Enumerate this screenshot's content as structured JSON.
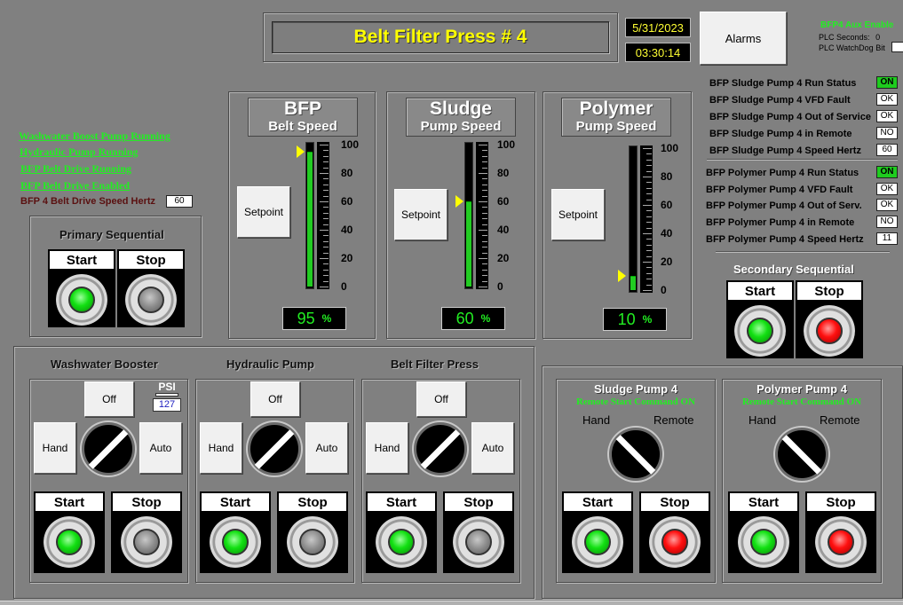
{
  "header": {
    "title": "Belt Filter Press # 4",
    "date": "5/31/2023",
    "time": "03:30:14",
    "alarms_label": "Alarms"
  },
  "aux": {
    "title": "BFP4 Aux Enable",
    "plc_seconds_label": "PLC Seconds:",
    "plc_seconds_value": "0",
    "plc_watchdog_label": "PLC WatchDog Bit"
  },
  "left_status": {
    "items": [
      "Washwater Boost Pump Running",
      "Hydraulic Pump Running",
      "BFP Belt Drive Running",
      "BFP Belt Drive Enabled"
    ],
    "speed_label": "BFP 4 Belt Drive Speed Hertz",
    "speed_value": "60"
  },
  "primary_seq": {
    "title": "Primary Sequential",
    "start": "Start",
    "stop": "Stop"
  },
  "secondary_seq": {
    "title": "Secondary Sequential",
    "start": "Start",
    "stop": "Stop"
  },
  "gauges": [
    {
      "title": "BFP",
      "subtitle": "Belt Speed",
      "setpoint": "Setpoint",
      "value": 95,
      "readout": "95",
      "unit": "%"
    },
    {
      "title": "Sludge",
      "subtitle": "Pump Speed",
      "setpoint": "Setpoint",
      "value": 60,
      "readout": "60",
      "unit": "%"
    },
    {
      "title": "Polymer",
      "subtitle": "Pump Speed",
      "setpoint": "Setpoint",
      "value": 10,
      "readout": "10",
      "unit": "%"
    }
  ],
  "scale_ticks": [
    "100",
    "80",
    "60",
    "40",
    "20",
    "0"
  ],
  "sludge_status": [
    {
      "label": "BFP Sludge Pump 4 Run Status",
      "value": "ON"
    },
    {
      "label": "BFP Sludge Pump 4 VFD Fault",
      "value": "OK"
    },
    {
      "label": "BFP Sludge Pump 4 Out of Service",
      "value": "OK"
    },
    {
      "label": "BFP Sludge Pump 4 in Remote",
      "value": "NO"
    },
    {
      "label": "BFP Sludge Pump 4 Speed Hertz",
      "value": "60"
    }
  ],
  "polymer_status": [
    {
      "label": "BFP Polymer Pump 4 Run Status",
      "value": "ON"
    },
    {
      "label": "BFP Polymer Pump 4 VFD Fault",
      "value": "OK"
    },
    {
      "label": "BFP Polymer Pump 4 Out of Serv.",
      "value": "OK"
    },
    {
      "label": "BFP Polymer Pump 4 in Remote",
      "value": "NO"
    },
    {
      "label": "BFP Polymer Pump 4 Speed Hertz",
      "value": "11"
    }
  ],
  "hoa": [
    {
      "title": "Washwater Booster",
      "off": "Off",
      "hand": "Hand",
      "auto": "Auto",
      "start": "Start",
      "stop": "Stop",
      "psi_label": "PSI",
      "psi_value": "127"
    },
    {
      "title": "Hydraulic Pump",
      "off": "Off",
      "hand": "Hand",
      "auto": "Auto",
      "start": "Start",
      "stop": "Stop"
    },
    {
      "title": "Belt Filter Press",
      "off": "Off",
      "hand": "Hand",
      "auto": "Auto",
      "start": "Start",
      "stop": "Stop"
    }
  ],
  "pumps": [
    {
      "title": "Sludge Pump 4",
      "command": "Remote Start Command ON",
      "hand": "Hand",
      "remote": "Remote",
      "start": "Start",
      "stop": "Stop"
    },
    {
      "title": "Polymer Pump 4",
      "command": "Remote Start Command ON",
      "hand": "Hand",
      "remote": "Remote",
      "start": "Start",
      "stop": "Stop"
    }
  ],
  "colors": {
    "background": "#808080",
    "title_text": "#ffff00",
    "indicator_green": "#22ee22",
    "on_badge": "#1ecc1e",
    "lamp_red": "#ff1010"
  }
}
